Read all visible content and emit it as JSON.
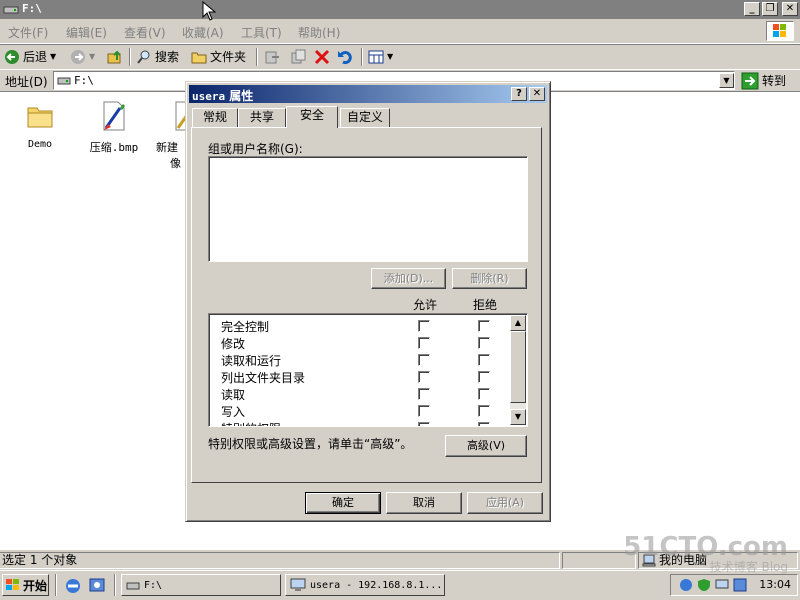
{
  "window": {
    "title": "F:\\"
  },
  "menu": [
    "文件(F)",
    "编辑(E)",
    "查看(V)",
    "收藏(A)",
    "工具(T)",
    "帮助(H)"
  ],
  "toolbar": {
    "back_label": "后退",
    "search_label": "搜索",
    "folders_label": "文件夹"
  },
  "address": {
    "label": "地址(D)",
    "value": "F:\\",
    "go_label": "转到"
  },
  "files": [
    {
      "name": "Demo",
      "icon": "folder-icon"
    },
    {
      "name": "压缩.bmp",
      "icon": "bitmap-file-icon"
    },
    {
      "name": "新建",
      "name2": "像",
      "icon": "new-file-icon"
    }
  ],
  "status": {
    "left": "选定 1 个对象",
    "right": "我的电脑"
  },
  "taskbar": {
    "start_label": "开始",
    "tasks": [
      "F:\\",
      "usera - 192.168.8.1..."
    ],
    "clock": "13:04"
  },
  "dialog": {
    "title_name": "usera",
    "title_suffix": " 属性",
    "tabs": [
      "常规",
      "共享",
      "安全",
      "自定义"
    ],
    "active_tab": "安全",
    "group_label": "组或用户名称(G):",
    "add_label": "添加(D)...",
    "remove_label": "删除(R)",
    "allow_header": "允许",
    "deny_header": "拒绝",
    "permissions": [
      {
        "name": "完全控制",
        "allow": false,
        "deny": false
      },
      {
        "name": "修改",
        "allow": false,
        "deny": false
      },
      {
        "name": "读取和运行",
        "allow": false,
        "deny": false
      },
      {
        "name": "列出文件夹目录",
        "allow": false,
        "deny": false
      },
      {
        "name": "读取",
        "allow": false,
        "deny": false
      },
      {
        "name": "写入",
        "allow": false,
        "deny": false
      },
      {
        "name": "特别的权限",
        "allow": false,
        "deny": false
      }
    ],
    "advanced_text": "特别权限或高级设置，请单击“高级”。",
    "advanced_label": "高级(V)",
    "ok_label": "确定",
    "cancel_label": "取消",
    "apply_label": "应用(A)"
  },
  "watermark": {
    "main": "51CTO.com",
    "sub": "技术博客 Blog"
  },
  "colors": {
    "title_active": "#0a246a",
    "title_active_end": "#a6caf0",
    "title_inactive": "#808080",
    "face": "#d4d0c8"
  }
}
